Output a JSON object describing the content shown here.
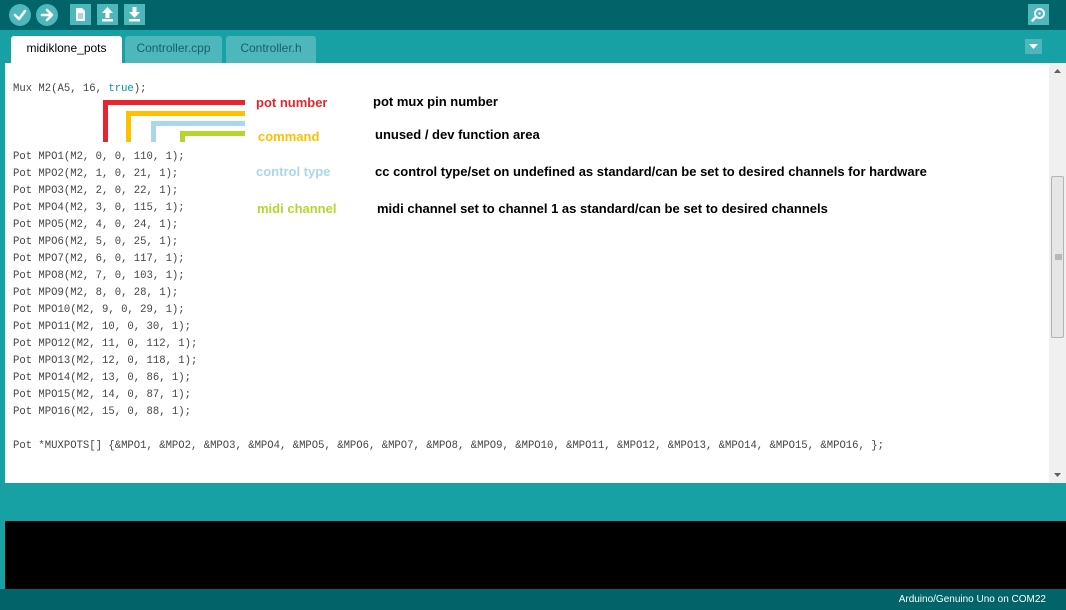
{
  "toolbar": {
    "buttons": [
      {
        "name": "verify-button",
        "icon": "check-icon"
      },
      {
        "name": "upload-button",
        "icon": "arrow-right-icon"
      },
      {
        "name": "new-button",
        "icon": "document-icon"
      },
      {
        "name": "open-button",
        "icon": "arrow-up-icon"
      },
      {
        "name": "save-button",
        "icon": "arrow-down-icon"
      }
    ],
    "serial_monitor_icon": "magnifier-icon"
  },
  "tabs": [
    {
      "label": "midiklone_pots",
      "active": true
    },
    {
      "label": "Controller.cpp",
      "active": false
    },
    {
      "label": "Controller.h",
      "active": false
    }
  ],
  "tab_menu_icon": "chevron-down-icon",
  "code": {
    "mux_line_prefix": "Mux M2(A5, 16, ",
    "mux_line_keyword": "true",
    "mux_line_suffix": ");",
    "pot_lines": [
      "Pot MPO1(M2, 0, 0, 110, 1);",
      "Pot MPO2(M2, 1, 0, 21, 1);",
      "Pot MPO3(M2, 2, 0, 22, 1);",
      "Pot MPO4(M2, 3, 0, 115, 1);",
      "Pot MPO5(M2, 4, 0, 24, 1);",
      "Pot MPO6(M2, 5, 0, 25, 1);",
      "Pot MPO7(M2, 6, 0, 117, 1);",
      "Pot MPO8(M2, 7, 0, 103, 1);",
      "Pot MPO9(M2, 8, 0, 28, 1);",
      "Pot MPO10(M2, 9, 0, 29, 1);",
      "Pot MPO11(M2, 10, 0, 30, 1);",
      "Pot MPO12(M2, 11, 0, 112, 1);",
      "Pot MPO13(M2, 12, 0, 118, 1);",
      "Pot MPO14(M2, 13, 0, 86, 1);",
      "Pot MPO15(M2, 14, 0, 87, 1);",
      "Pot MPO16(M2, 15, 0, 88, 1);"
    ],
    "muxpots_line": "Pot *MUXPOTS[] {&MPO1, &MPO2, &MPO3, &MPO4, &MPO5, &MPO6, &MPO7, &MPO8, &MPO9, &MPO10, &MPO11, &MPO12, &MPO13, &MPO14, &MPO15, &MPO16, };"
  },
  "annotations": [
    {
      "label": "pot number",
      "color": "#e8242e",
      "description": "pot mux pin number"
    },
    {
      "label": "command",
      "color": "#ffc000",
      "description": "unused / dev function area"
    },
    {
      "label": "control type",
      "color": "#a8d8ea",
      "description": "cc control type/set on undefined as standard/can be set to desired channels for hardware"
    },
    {
      "label": "midi channel",
      "color": "#b6d62f",
      "description": "midi channel set to channel 1 as standard/can be set to desired channels"
    }
  ],
  "status": {
    "board_port": "Arduino/Genuino Uno on COM22"
  },
  "colors": {
    "toolbar_bg": "#006468",
    "tabbar_bg": "#17a1a5",
    "button_bg": "#4db7bb",
    "keyword": "#00979c"
  }
}
